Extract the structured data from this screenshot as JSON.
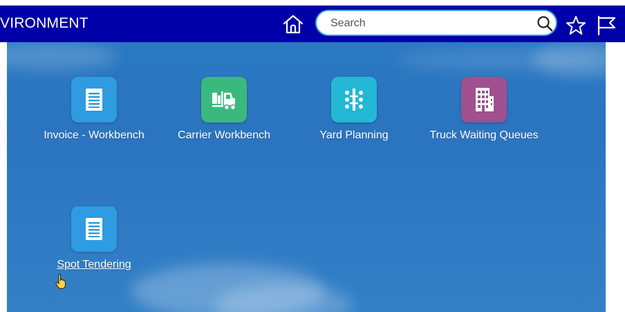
{
  "header": {
    "env_title": "VIRONMENT",
    "search_placeholder": "Search",
    "bg_color": "#0000a8",
    "icons": [
      "home-icon",
      "search-icon",
      "star-icon",
      "flag-icon"
    ]
  },
  "tiles": [
    {
      "label": "Invoice - Workbench",
      "icon": "document-icon",
      "color": "#2f9be0"
    },
    {
      "label": "Carrier Workbench",
      "icon": "forklift-icon",
      "color": "#3bb87e"
    },
    {
      "label": "Yard Planning",
      "icon": "yard-icon",
      "color": "#22b8d6"
    },
    {
      "label": "Truck Waiting Queues",
      "icon": "building-icon",
      "color": "#a0508e"
    },
    {
      "label": "Spot Tendering",
      "icon": "document-icon",
      "color": "#2f9be0"
    }
  ]
}
